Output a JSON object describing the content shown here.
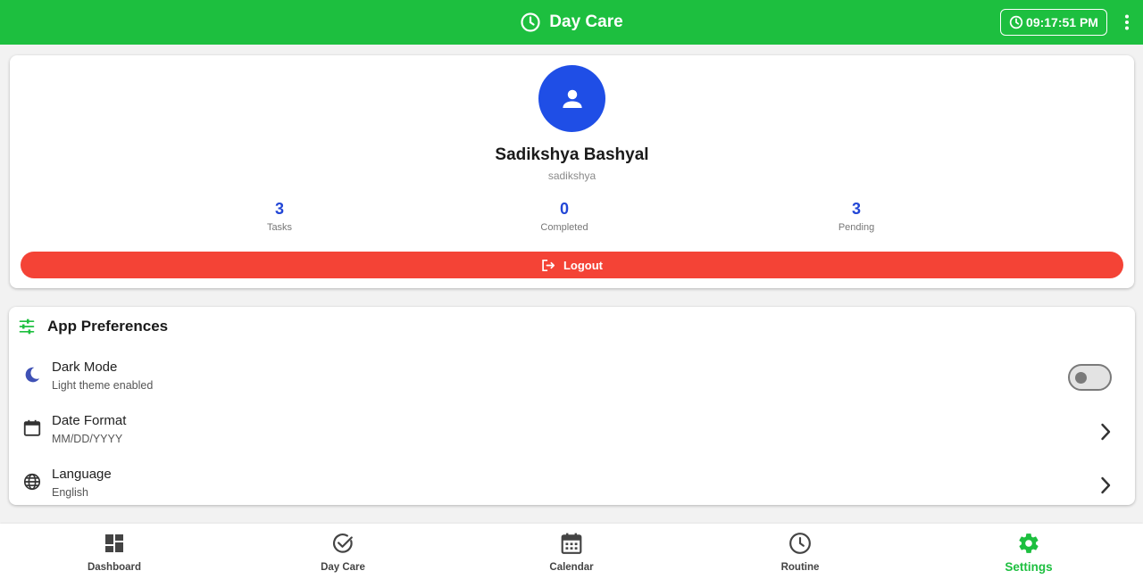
{
  "app_bar": {
    "title": "Day Care",
    "clock_time": "09:17:51 PM",
    "title_icon": "clock-icon",
    "menu_icon": "more-vert-icon"
  },
  "profile": {
    "name": "Sadikshya Bashyal",
    "username": "sadikshya",
    "avatar_icon": "person-icon",
    "stats": [
      {
        "value": "3",
        "label": "Tasks"
      },
      {
        "value": "0",
        "label": "Completed"
      },
      {
        "value": "3",
        "label": "Pending"
      }
    ],
    "logout_label": "Logout"
  },
  "preferences": {
    "title": "App Preferences",
    "items": [
      {
        "title": "Dark Mode",
        "subtitle": "Light theme enabled",
        "icon": "moon-icon",
        "control": "toggle",
        "enabled": false
      },
      {
        "title": "Date Format",
        "subtitle": "MM/DD/YYYY",
        "icon": "calendar-icon",
        "control": "chevron"
      },
      {
        "title": "Language",
        "subtitle": "English",
        "icon": "globe-icon",
        "control": "chevron"
      }
    ]
  },
  "bottom_nav": {
    "items": [
      {
        "label": "Dashboard",
        "icon": "dashboard-icon"
      },
      {
        "label": "Day Care",
        "icon": "check-circle-icon"
      },
      {
        "label": "Calendar",
        "icon": "calendar-icon"
      },
      {
        "label": "Routine",
        "icon": "clock-icon"
      },
      {
        "label": "Settings",
        "icon": "gear-icon"
      }
    ],
    "active": "Settings"
  },
  "colors": {
    "primary_green": "#1dbf3f",
    "accent_blue": "#1f4ee6",
    "stat_blue": "#2246d6",
    "logout_red": "#f44336",
    "moon_blue": "#3f51b5"
  }
}
